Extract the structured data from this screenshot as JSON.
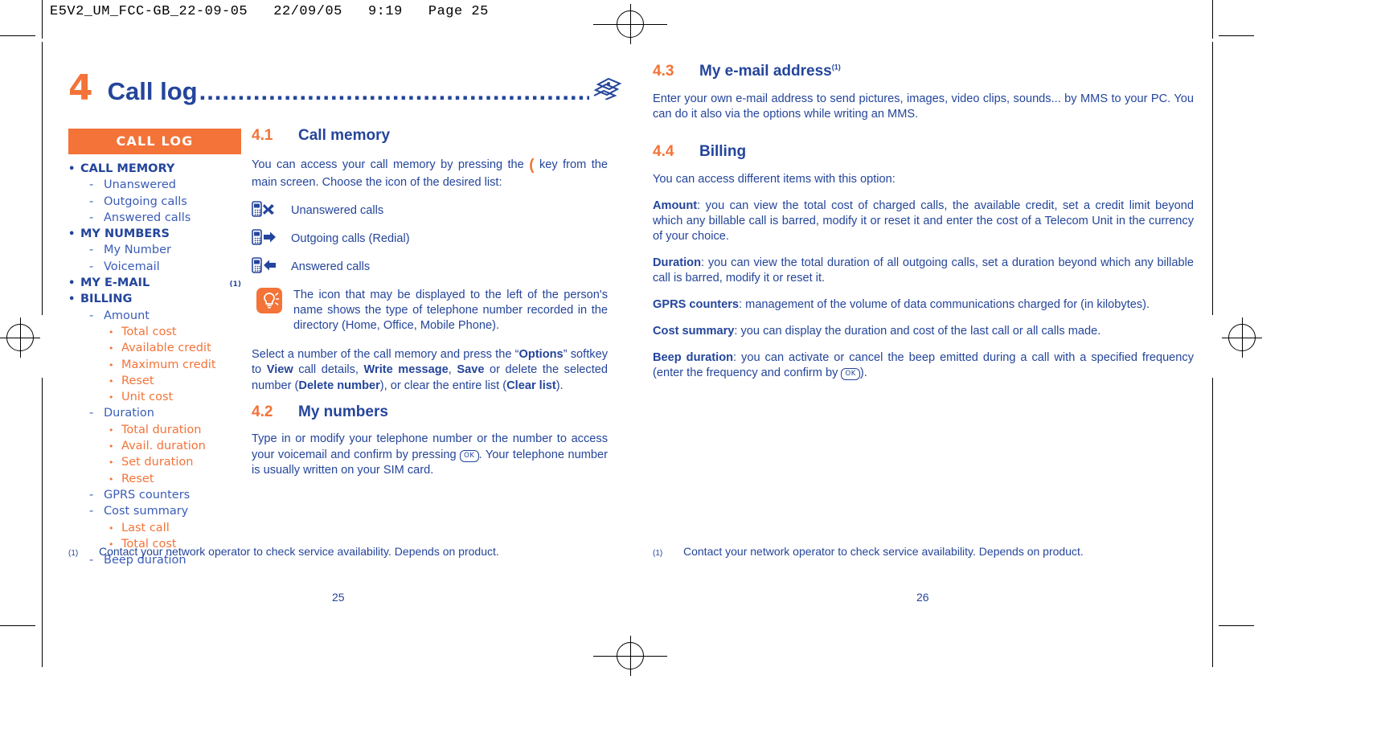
{
  "print_header": "E5V2_UM_FCC-GB_22-09-05   22/09/05   9:19   Page 25",
  "chapter": {
    "number": "4",
    "title": "Call log",
    "leader": "..........................................................",
    "icon": "fax-machine-icon"
  },
  "sidebar": {
    "header": "CALL LOG",
    "items": [
      {
        "level": 1,
        "bullet": "•",
        "label": "CALL MEMORY"
      },
      {
        "level": 2,
        "bullet": "-",
        "label": "Unanswered"
      },
      {
        "level": 2,
        "bullet": "-",
        "label": "Outgoing calls"
      },
      {
        "level": 2,
        "bullet": "-",
        "label": "Answered calls"
      },
      {
        "level": 1,
        "bullet": "•",
        "label": "MY NUMBERS"
      },
      {
        "level": 2,
        "bullet": "-",
        "label": "My Number"
      },
      {
        "level": 2,
        "bullet": "-",
        "label": "Voicemail"
      },
      {
        "level": 1,
        "bullet": "•",
        "label": "MY E-MAIL",
        "footnote": "(1)"
      },
      {
        "level": 1,
        "bullet": "•",
        "label": "BILLING"
      },
      {
        "level": 2,
        "bullet": "-",
        "label": "Amount"
      },
      {
        "level": 3,
        "bullet": "•",
        "label": "Total cost"
      },
      {
        "level": 3,
        "bullet": "•",
        "label": "Available credit"
      },
      {
        "level": 3,
        "bullet": "•",
        "label": "Maximum credit"
      },
      {
        "level": 3,
        "bullet": "•",
        "label": "Reset"
      },
      {
        "level": 3,
        "bullet": "•",
        "label": "Unit cost"
      },
      {
        "level": 2,
        "bullet": "-",
        "label": "Duration"
      },
      {
        "level": 3,
        "bullet": "•",
        "label": "Total duration"
      },
      {
        "level": 3,
        "bullet": "•",
        "label": "Avail. duration"
      },
      {
        "level": 3,
        "bullet": "•",
        "label": "Set duration"
      },
      {
        "level": 3,
        "bullet": "•",
        "label": "Reset"
      },
      {
        "level": 2,
        "bullet": "-",
        "label": "GPRS counters"
      },
      {
        "level": 2,
        "bullet": "-",
        "label": "Cost summary"
      },
      {
        "level": 3,
        "bullet": "•",
        "label": "Last call"
      },
      {
        "level": 3,
        "bullet": "•",
        "label": "Total cost"
      },
      {
        "level": 2,
        "bullet": "-",
        "label": "Beep duration"
      }
    ]
  },
  "middle_column": {
    "section_41": {
      "number": "4.1",
      "title": "Call memory",
      "intro_a": "You can access your call memory by pressing the",
      "intro_b": "key from the main screen. Choose the icon of the desired list:",
      "call_key_glyph": "(",
      "list": [
        {
          "icon": "phone-missed-call-icon",
          "label": "Unanswered calls"
        },
        {
          "icon": "phone-outgoing-call-icon",
          "label": "Outgoing calls (Redial)"
        },
        {
          "icon": "phone-answered-call-icon",
          "label": "Answered calls"
        }
      ],
      "tip": {
        "icon": "lightbulb-tip-icon",
        "text": "The icon that may be displayed to the left of the person's name shows the type of telephone number recorded in the directory (Home, Office, Mobile Phone)."
      },
      "para_select": {
        "t1": "Select a number of the call memory and press the “",
        "b1": "Options",
        "t2": "” softkey to ",
        "b2": "View",
        "t3": " call details, ",
        "b3": "Write message",
        "t4": ", ",
        "b4": "Save",
        "t5": " or delete the selected number (",
        "b5": "Delete number",
        "t6": "), or clear the entire list (",
        "b6": "Clear list",
        "t7": ")."
      }
    },
    "section_42": {
      "number": "4.2",
      "title": "My numbers",
      "text_a": "Type in or modify your telephone number or the number to access your voicemail and confirm by pressing",
      "ok_key": "OK",
      "text_b": ". Your telephone number is usually written on your SIM card."
    }
  },
  "right_column": {
    "section_43": {
      "number": "4.3",
      "title": "My e-mail address",
      "footnote": "(1)",
      "text": "Enter your own e-mail address to send pictures, images, video clips, sounds... by MMS to your PC. You can do it also via the options while writing an MMS."
    },
    "section_44": {
      "number": "4.4",
      "title": "Billing",
      "intro": "You can access different items with this option:",
      "entries": [
        {
          "term": "Amount",
          "text": ": you can view the total cost of charged calls, the available credit, set a credit limit beyond which any billable call is barred, modify it or reset it and enter the cost of a Telecom Unit in the currency of your choice."
        },
        {
          "term": "Duration",
          "text": ": you can view the total duration of all outgoing calls, set a duration beyond which any billable call is barred, modify it or reset it."
        },
        {
          "term": "GPRS counters",
          "text": ": management of the volume of data communications charged for (in kilobytes)."
        },
        {
          "term": "Cost summary",
          "text": ": you can display the duration and cost of the last call or all calls made."
        }
      ],
      "beep": {
        "term": "Beep duration",
        "text_a": ": you can activate or cancel the beep emitted during a call with a specified frequency (enter the frequency and confirm by",
        "ok_key": "OK",
        "text_b": ")."
      }
    }
  },
  "footnotes": {
    "left": {
      "mark": "(1)",
      "text": "Contact your network operator to check service availability. Depends on product."
    },
    "right": {
      "mark": "(1)",
      "text": "Contact your network operator to check service availability. Depends on product."
    }
  },
  "page_numbers": {
    "left": "25",
    "right": "26"
  },
  "colors": {
    "blue": "#24459B",
    "blue_mid": "#3A5CB8",
    "orange": "#F37338",
    "white": "#FFFFFF"
  }
}
